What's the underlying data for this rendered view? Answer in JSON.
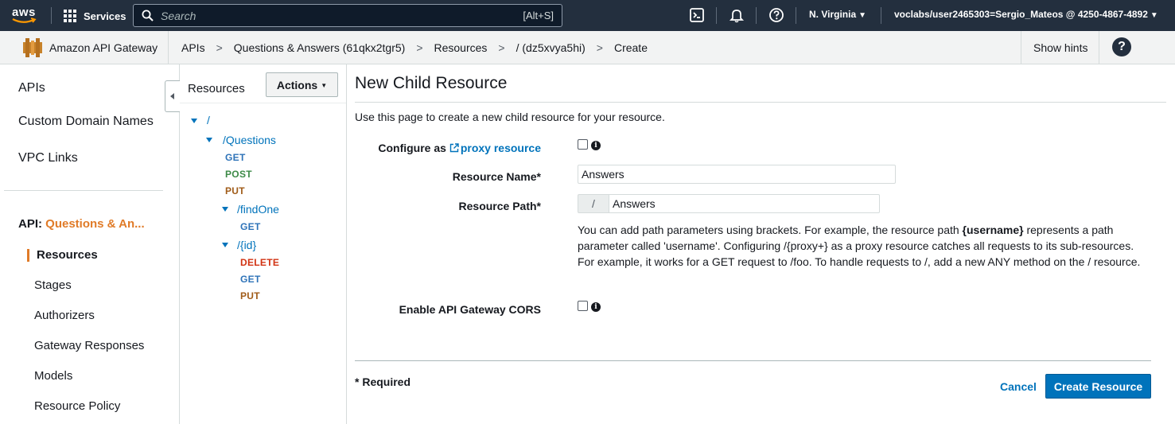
{
  "topnav": {
    "logo_text": "aws",
    "services_label": "Services",
    "search_placeholder": "Search",
    "search_shortcut": "[Alt+S]",
    "region": "N. Virginia",
    "account": "voclabs/user2465303=Sergio_Mateos @ 4250-4867-4892",
    "icons": [
      "cloudshell-icon",
      "bell-icon",
      "help-circle-icon"
    ]
  },
  "breadcrumb": {
    "service": "Amazon API Gateway",
    "items": [
      "APIs",
      "Questions & Answers (61qkx2tgr5)",
      "Resources",
      "/ (dz5xvya5hi)",
      "Create"
    ],
    "separator": ">",
    "show_hints": "Show hints",
    "help": "?"
  },
  "sidebar": {
    "top_items": [
      "APIs",
      "Custom Domain Names",
      "VPC Links"
    ],
    "api_prefix": "API:",
    "api_name": "Questions & An...",
    "sub_items": [
      "Resources",
      "Stages",
      "Authorizers",
      "Gateway Responses",
      "Models",
      "Resource Policy"
    ],
    "active_item": "Resources"
  },
  "resources_panel": {
    "title": "Resources",
    "actions_label": "Actions",
    "tree": [
      {
        "path": "/",
        "level": 0
      },
      {
        "path": "/Questions",
        "level": 1,
        "methods": [
          "GET",
          "POST",
          "PUT"
        ]
      },
      {
        "path": "/findOne",
        "level": 2,
        "methods": [
          "GET"
        ]
      },
      {
        "path": "/{id}",
        "level": 2,
        "methods": [
          "DELETE",
          "GET",
          "PUT"
        ]
      }
    ],
    "method_colors": {
      "GET": "#2e73b8",
      "POST": "#3d8a47",
      "PUT": "#a05b18",
      "DELETE": "#d13212"
    }
  },
  "form": {
    "title": "New Child Resource",
    "intro": "Use this page to create a new child resource for your resource.",
    "configure_prefix": "Configure as",
    "proxy_link": "proxy resource",
    "proxy_checked": false,
    "name_label": "Resource Name*",
    "name_value": "Answers",
    "path_label": "Resource Path*",
    "path_prefix": "/",
    "path_value": "Answers",
    "help_1": "You can add path parameters using brackets. For example, the resource path",
    "help_param": "{username}",
    "help_2": "represents a path parameter called 'username'. Configuring /{proxy+} as a proxy resource catches all requests to its sub-resources. For example, it works for a GET request to /foo. To handle requests to /, add a new ANY method on the / resource.",
    "cors_label": "Enable API Gateway CORS",
    "cors_checked": false,
    "required_note": "* Required",
    "cancel_label": "Cancel",
    "create_label": "Create Resource"
  },
  "colors": {
    "nav_bg": "#232f3e",
    "accent_orange": "#e07b28",
    "link_blue": "#0073bb",
    "primary_button": "#0073bb"
  }
}
